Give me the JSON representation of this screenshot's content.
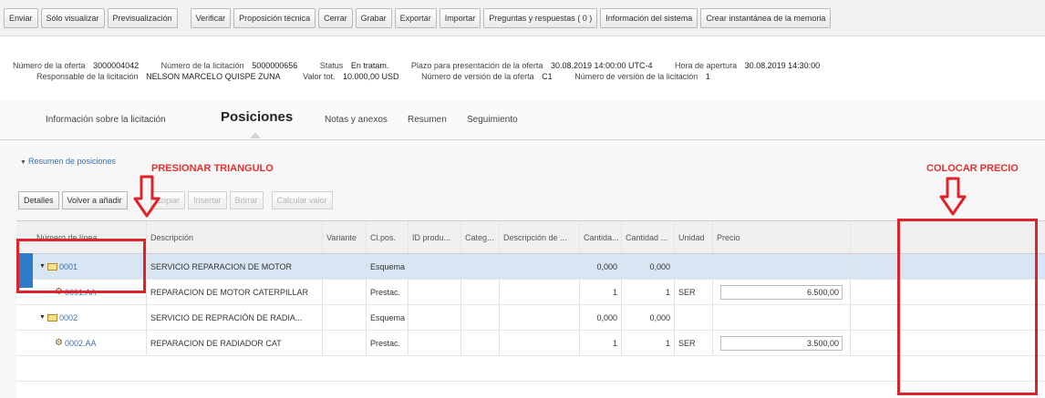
{
  "toolbar": {
    "buttons": [
      "Enviar",
      "Sólo visualizar",
      "Previsualización",
      "Verificar",
      "Proposición técnica",
      "Cerrar",
      "Grabar",
      "Exportar",
      "Importar",
      "Preguntas y respuestas ( 0 )",
      "Información del sistema",
      "Crear instantánea de la memoria"
    ]
  },
  "header": {
    "offer_number_label": "Número de la oferta",
    "offer_number": "3000004042",
    "tender_number_label": "Número de la licitación",
    "tender_number": "5000000656",
    "status_label": "Status",
    "status": "En tratam.",
    "deadline_label": "Plazo para presentación de la oferta",
    "deadline": "30.08.2019 14:00:00 UTC-4",
    "opening_label": "Hora de apertura",
    "opening": "30.08.2019 14:30:00",
    "responsible_label": "Responsable de la licitación",
    "responsible": "NELSON MARCELO QUISPE ZUNA",
    "total_label": "Valor tot.",
    "total": "10.000,00 USD",
    "offer_version_label": "Número de versión de la oferta",
    "offer_version": "C1",
    "tender_version_label": "Número de versión de la licitación",
    "tender_version": "1"
  },
  "tabs": [
    "Información sobre la licitación",
    "Posiciones",
    "Notas y anexos",
    "Resumen",
    "Seguimiento"
  ],
  "summary_link": "Resumen de posiciones",
  "annotations": {
    "press_triangle": "PRESIONAR TRIANGULO",
    "enter_price": "COLOCAR PRECIO"
  },
  "grid_toolbar": {
    "buttons": [
      "Detalles",
      "Volver a añadir",
      "Copiar",
      "Insertar",
      "Borrar",
      "Calcular valor"
    ]
  },
  "columns": [
    "Número de línea",
    "Descripción",
    "Variante",
    "Cl.pos.",
    "ID produ...",
    "Categ...",
    "Descripción de ...",
    "Cantida...",
    "Cantidad ...",
    "Unidad",
    "Precio"
  ],
  "rows": [
    {
      "line": "0001",
      "description": "SERVICIO REPARACION DE MOTOR",
      "class": "Esquema",
      "qty1": "0,000",
      "qty2": "0,000",
      "unit": "",
      "price": ""
    },
    {
      "line": "0001.AA",
      "description": "REPARACION DE MOTOR CATERPILLAR",
      "class": "Prestac.",
      "qty1": "1",
      "qty2": "1",
      "unit": "SER",
      "price": "6.500,00"
    },
    {
      "line": "0002",
      "description": "SERVICIO DE REPRACIÓN DE RADIA...",
      "class": "Esquema",
      "qty1": "0,000",
      "qty2": "0,000",
      "unit": "",
      "price": ""
    },
    {
      "line": "0002.AA",
      "description": "REPARACION DE RADIADOR CAT",
      "class": "Prestac.",
      "qty1": "1",
      "qty2": "1",
      "unit": "SER",
      "price": "3.500,00"
    }
  ]
}
